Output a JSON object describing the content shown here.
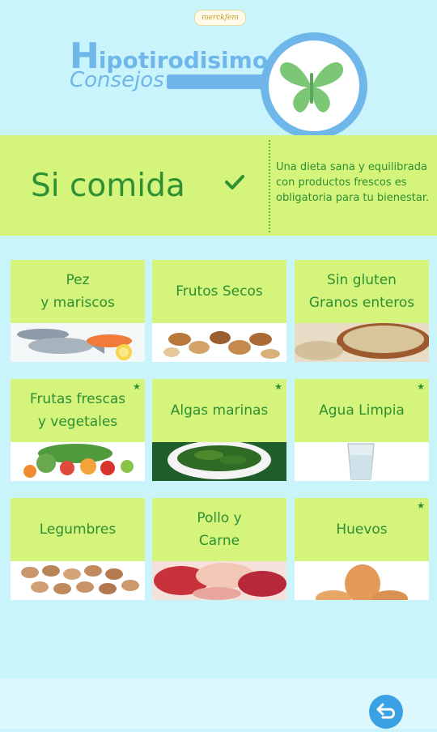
{
  "header": {
    "brand": "merckfem",
    "title_first": "H",
    "title_rest": "ipotirodisimo",
    "subtitle": "Consejos"
  },
  "banner": {
    "title": "Si comida",
    "description": "Una dieta sana y equilibrada con productos frescos es obligatoria para tu bienestar."
  },
  "tiles": [
    {
      "label": "Pez\ny mariscos",
      "starred": false,
      "icon": "fish-icon"
    },
    {
      "label": "Frutos Secos",
      "starred": false,
      "icon": "nuts-icon"
    },
    {
      "label": "Sin gluten\nGranos enteros",
      "starred": false,
      "icon": "grains-icon"
    },
    {
      "label": "Frutas frescas\ny vegetales",
      "starred": true,
      "icon": "vegetables-icon"
    },
    {
      "label": "Algas marinas",
      "starred": true,
      "icon": "seaweed-icon"
    },
    {
      "label": "Agua Limpia",
      "starred": true,
      "icon": "water-glass-icon"
    },
    {
      "label": "Legumbres",
      "starred": false,
      "icon": "beans-icon"
    },
    {
      "label": "Pollo y\nCarne",
      "starred": false,
      "icon": "meat-icon"
    },
    {
      "label": "Huevos",
      "starred": true,
      "icon": "eggs-icon"
    }
  ],
  "star_glyph": "★",
  "colors": {
    "background": "#c9f4fb",
    "accent_green": "#d4f47b",
    "text_green": "#2e8f33",
    "title_blue": "#6fb7ea",
    "button_blue": "#3aa2e4"
  }
}
